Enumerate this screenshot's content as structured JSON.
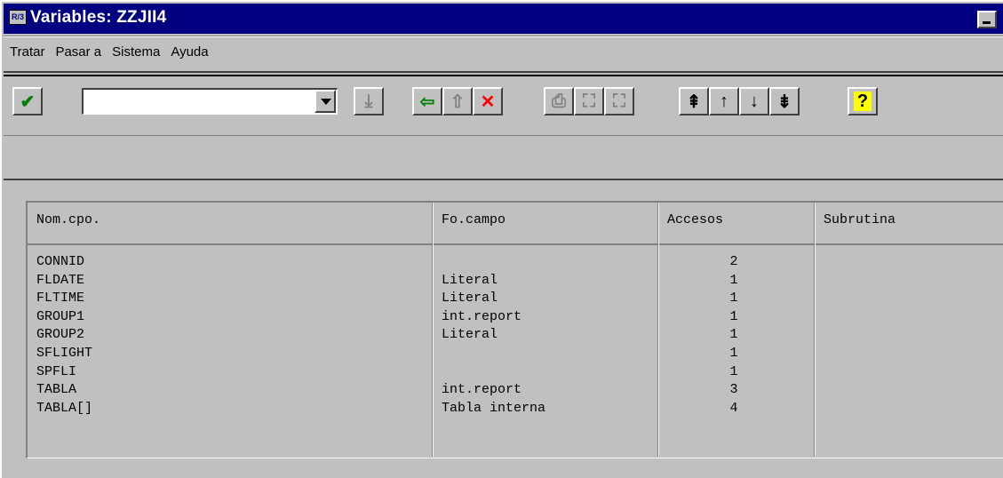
{
  "window": {
    "title": "Variables: ZZJII4",
    "icon_label": "R/3"
  },
  "menu": {
    "items": [
      "Tratar",
      "Pasar a",
      "Sistema",
      "Ayuda"
    ]
  },
  "toolbar": {
    "command_field_value": "",
    "buttons": [
      {
        "name": "enter-icon",
        "glyph": "✔",
        "color": "#008000"
      },
      {
        "name": "save-icon",
        "glyph": "⤓",
        "color": "#808080"
      },
      {
        "name": "back-icon",
        "glyph": "⇦",
        "color": "#008000"
      },
      {
        "name": "exit-icon",
        "glyph": "⇧",
        "color": "#808080"
      },
      {
        "name": "cancel-icon",
        "glyph": "✕",
        "color": "#ff0000"
      },
      {
        "name": "print-icon",
        "glyph": "⎙",
        "color": "#808080"
      },
      {
        "name": "find-icon",
        "glyph": "⛶",
        "color": "#808080"
      },
      {
        "name": "find-next-icon",
        "glyph": "⛶",
        "color": "#808080"
      },
      {
        "name": "first-page-icon",
        "glyph": "⇞",
        "color": "#000"
      },
      {
        "name": "previous-page-icon",
        "glyph": "↑",
        "color": "#000"
      },
      {
        "name": "next-page-icon",
        "glyph": "↓",
        "color": "#000"
      },
      {
        "name": "last-page-icon",
        "glyph": "⇟",
        "color": "#000"
      },
      {
        "name": "help-icon",
        "glyph": "?",
        "color": "#000"
      }
    ]
  },
  "table": {
    "headers": {
      "name": "Nom.cpo.",
      "origin": "Fo.campo",
      "accesses": "Accesos",
      "subroutine": "Subrutina"
    },
    "rows": [
      {
        "name": "CONNID",
        "origin": "",
        "accesses": "2",
        "subroutine": ""
      },
      {
        "name": "FLDATE",
        "origin": "Literal",
        "accesses": "1",
        "subroutine": ""
      },
      {
        "name": "FLTIME",
        "origin": "Literal",
        "accesses": "1",
        "subroutine": ""
      },
      {
        "name": "GROUP1",
        "origin": "int.report",
        "accesses": "1",
        "subroutine": ""
      },
      {
        "name": "GROUP2",
        "origin": "Literal",
        "accesses": "1",
        "subroutine": ""
      },
      {
        "name": "SFLIGHT",
        "origin": "",
        "accesses": "1",
        "subroutine": ""
      },
      {
        "name": "SPFLI",
        "origin": "",
        "accesses": "1",
        "subroutine": ""
      },
      {
        "name": "TABLA",
        "origin": "int.report",
        "accesses": "3",
        "subroutine": ""
      },
      {
        "name": "TABLA[]",
        "origin": "Tabla interna",
        "accesses": "4",
        "subroutine": ""
      }
    ]
  }
}
